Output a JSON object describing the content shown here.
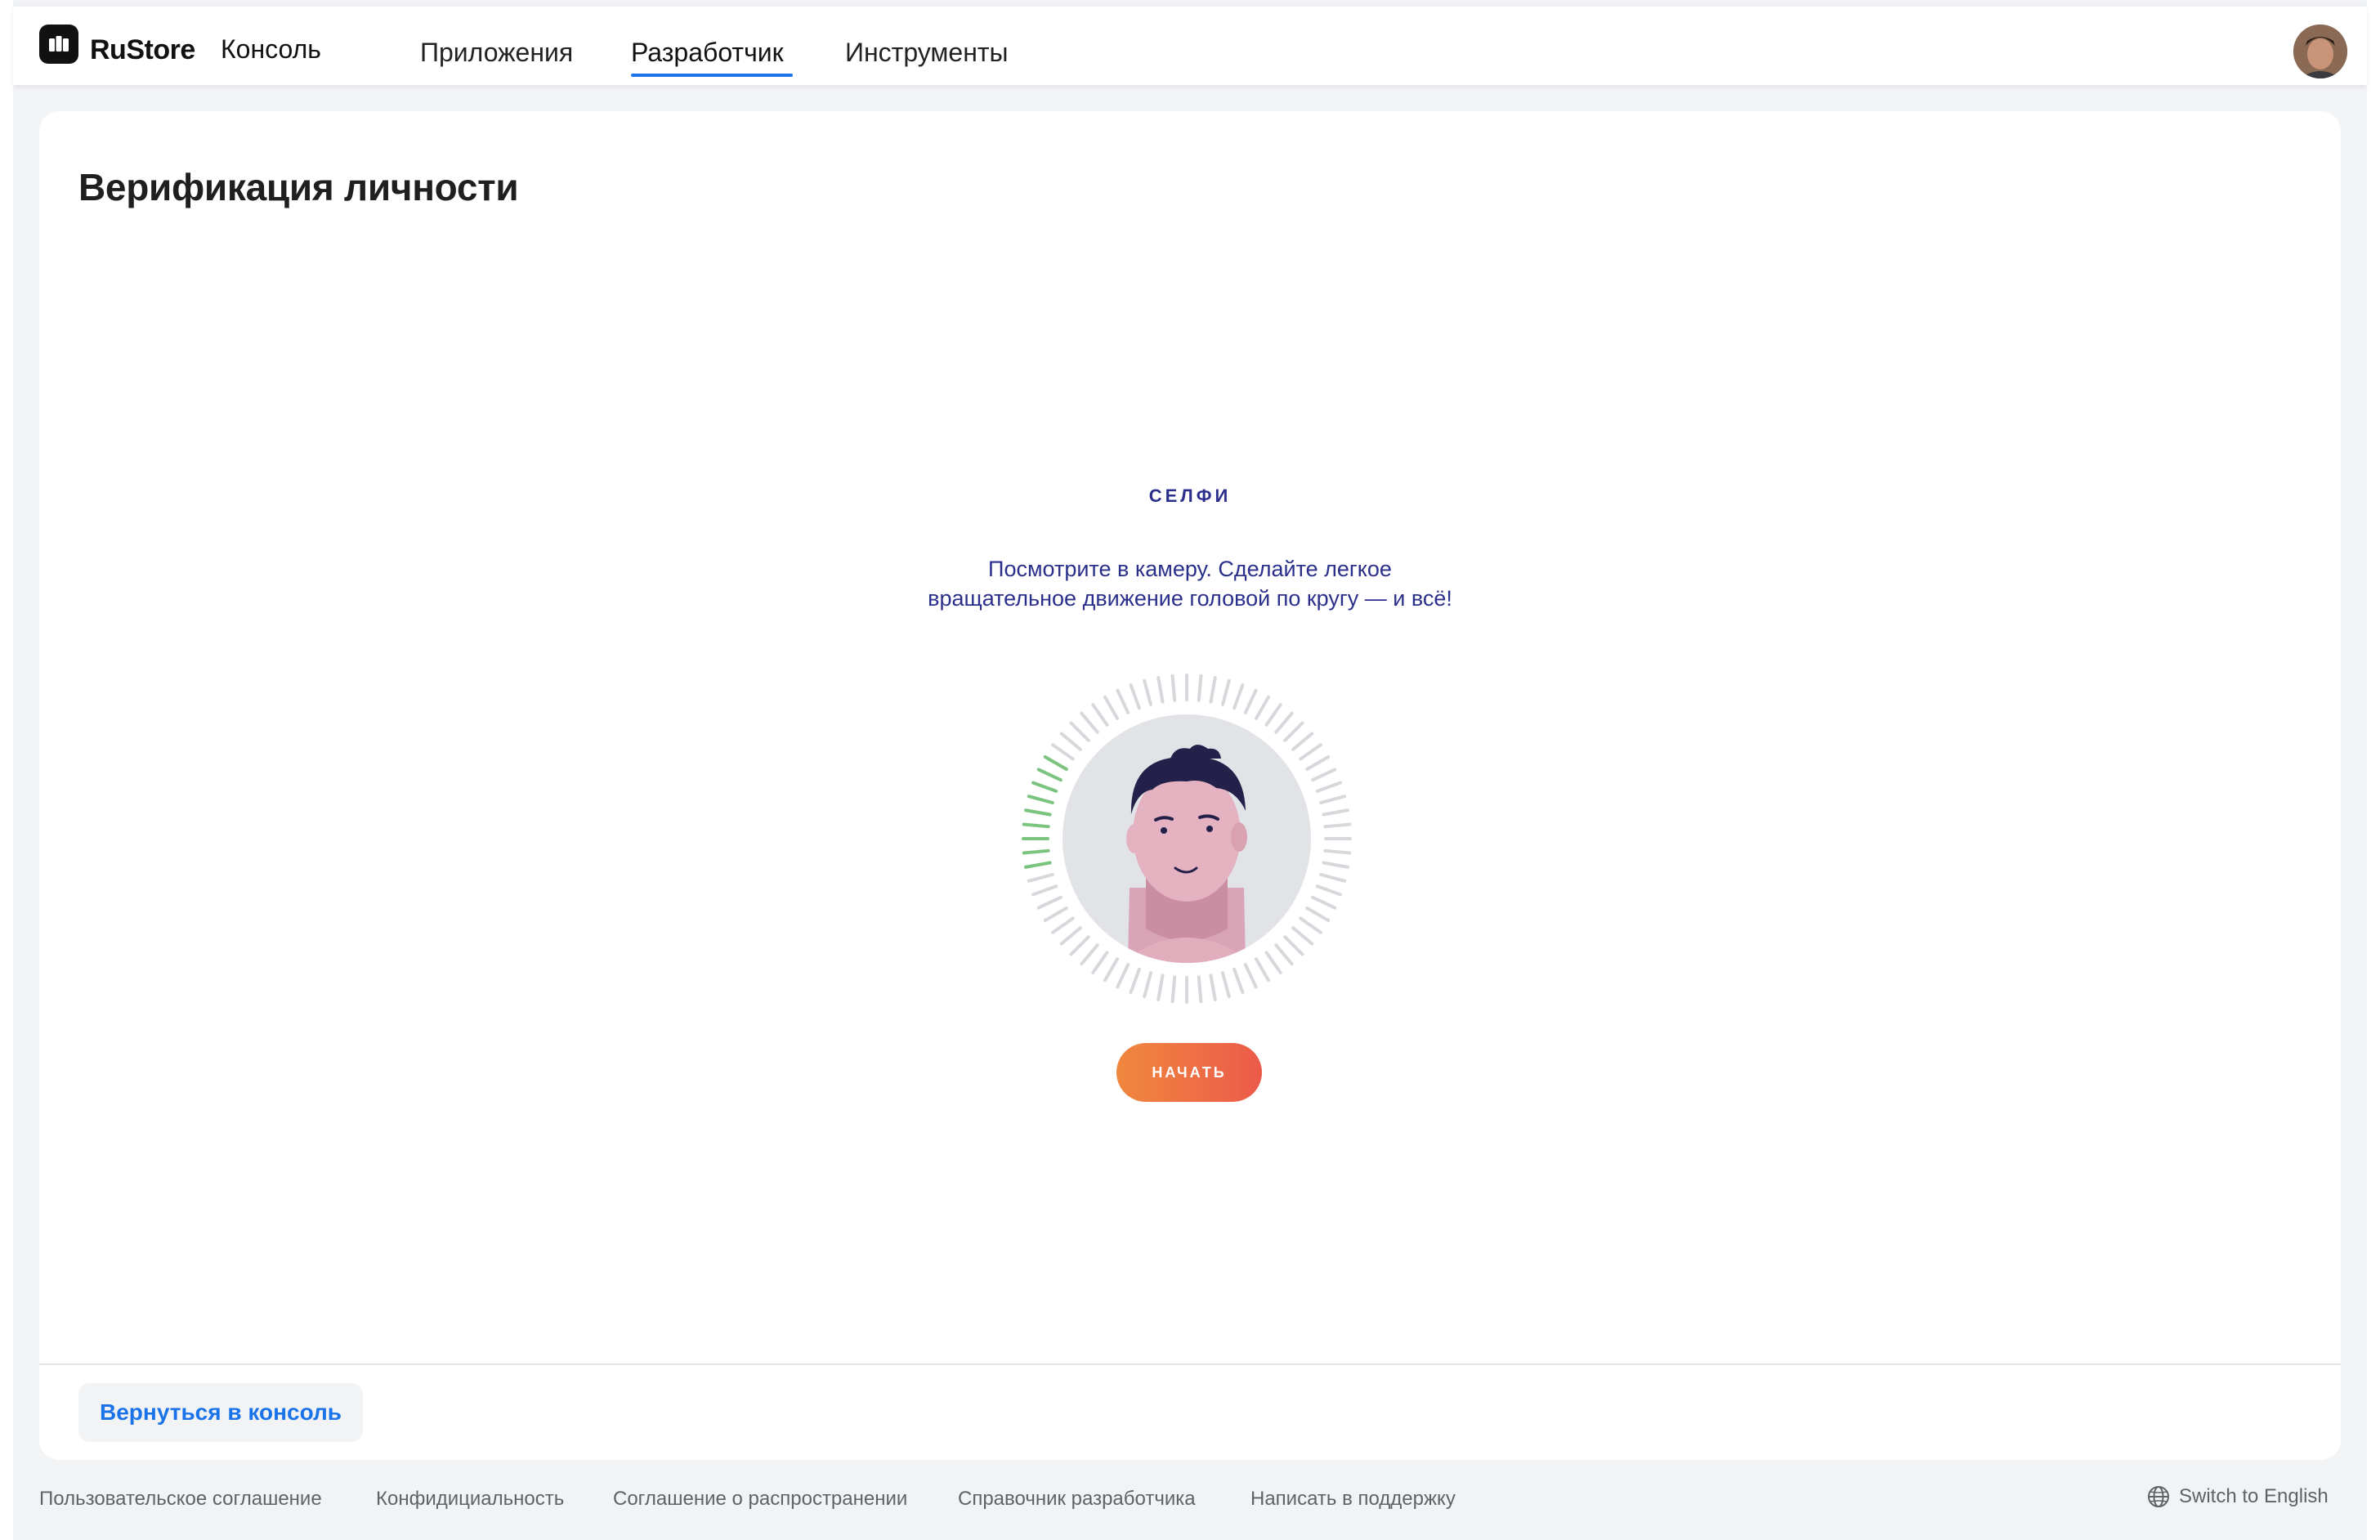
{
  "header": {
    "brand": "RuStore",
    "subtitle": "Консоль",
    "nav": [
      {
        "label": "Приложения",
        "active": false
      },
      {
        "label": "Разработчик",
        "active": true
      },
      {
        "label": "Инструменты",
        "active": false
      }
    ],
    "accent_color": "#1a73e8"
  },
  "main": {
    "page_title": "Верификация личности",
    "selfie": {
      "heading": "СЕЛФИ",
      "instruction_line1": "Посмотрите в камеру. Сделайте легкое",
      "instruction_line2": "вращательное движение головой по кругу — и всё!",
      "start_button": "НАЧАТЬ",
      "progress": 0.12,
      "progress_color": "#7bc47f",
      "text_color": "#2b2f8c"
    },
    "back_button": "Вернуться в консоль"
  },
  "footer": {
    "links": [
      "Пользовательское соглашение",
      "Конфидициальность",
      "Соглашение о распространении",
      "Справочник разработчика",
      "Написать в поддержку"
    ],
    "language_switch": "Switch to English",
    "language_icon": "globe-icon"
  }
}
